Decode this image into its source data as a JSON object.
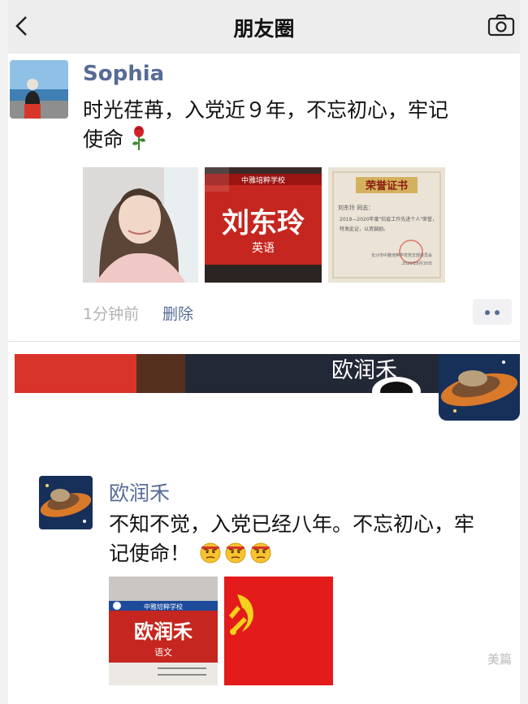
{
  "nav": {
    "title": "朋友圈",
    "back_icon": "chevron-left-icon",
    "camera_icon": "camera-icon"
  },
  "post1": {
    "author": "Sophia",
    "text_line1": "时光荏苒，入党近９年，不忘初心，牢记",
    "text_line2": "使命",
    "emoji": "rose-icon",
    "photos": [
      {
        "kind": "portrait-photo"
      },
      {
        "kind": "name-plate",
        "name": "刘东玲",
        "subject": "英语",
        "school": "中雅培粹学校"
      },
      {
        "kind": "certificate",
        "title": "荣誉证书",
        "line1": "刘东玲 同志：",
        "line2": "2019—2020年度\"抗疫工作先进个人\"荣誉，",
        "line3": "特发此证，以资鼓励。",
        "issuer": "长沙市中雅培粹学校党支部委员会",
        "date": "2020年8月30日"
      }
    ],
    "time": "1分钟前",
    "delete_label": "删除"
  },
  "strip": {
    "name": "欧润禾"
  },
  "post2": {
    "author": "欧润禾",
    "text_line1": "不知不觉，入党已经八年。不忘初心，牢",
    "text_line2": "记使命！",
    "emojis": [
      "smirk-emoji",
      "smirk-emoji",
      "smirk-emoji"
    ],
    "photos": [
      {
        "kind": "name-plate",
        "name": "欧润禾",
        "subject": "语文",
        "school": "中雅培粹学校"
      },
      {
        "kind": "party-flag"
      }
    ]
  },
  "watermark": "美篇",
  "colors": {
    "link": "#576b95",
    "nav_bg": "#ededed",
    "plate_red": "#c5261f",
    "flag_red": "#e31b1b",
    "gold": "#f4d11a"
  }
}
